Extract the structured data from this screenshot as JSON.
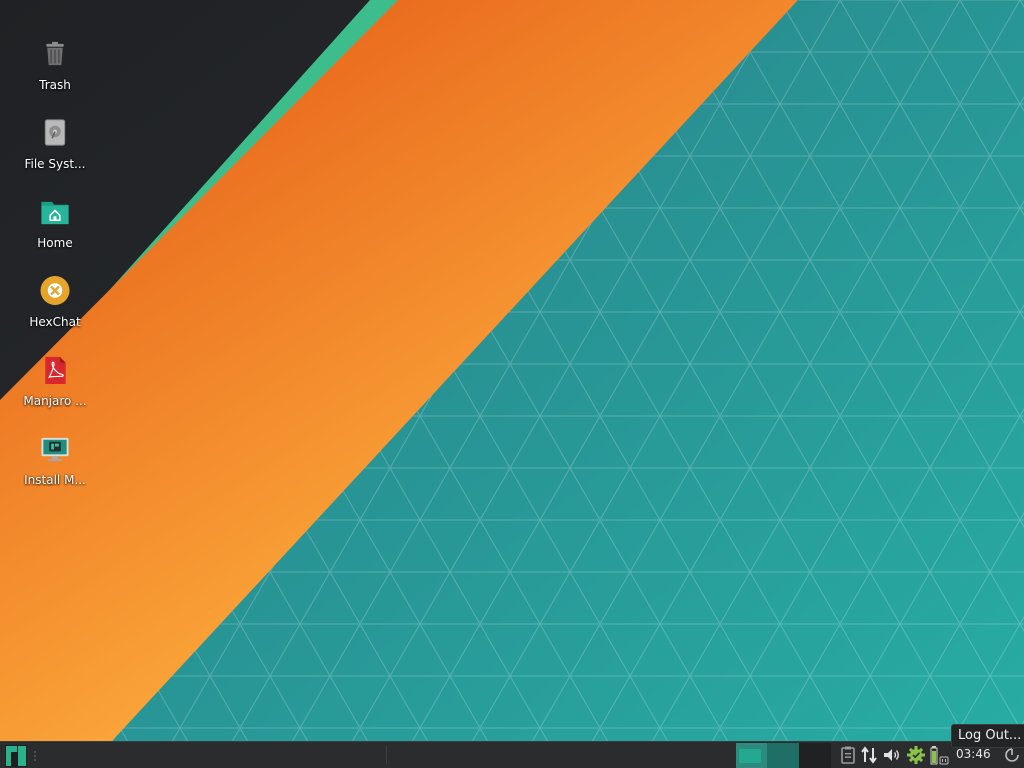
{
  "desktop": {
    "icons": [
      {
        "label": "Trash",
        "icon": "trash-icon"
      },
      {
        "label": "File Syst...",
        "icon": "drive-icon"
      },
      {
        "label": "Home",
        "icon": "home-folder-icon"
      },
      {
        "label": "HexChat",
        "icon": "hexchat-icon"
      },
      {
        "label": "Manjaro ...",
        "icon": "pdf-icon"
      },
      {
        "label": "Install M...",
        "icon": "installer-icon"
      }
    ]
  },
  "taskbar": {
    "menu_icon": "manjaro-logo-icon",
    "workspaces": [
      {
        "number": 1,
        "active": true
      },
      {
        "number": 2,
        "active": false
      },
      {
        "number": 3,
        "active": false
      }
    ],
    "tray_icons": [
      "clipboard-icon",
      "network-icon",
      "volume-icon",
      "update-gear-icon",
      "battery-icon",
      "power-icon"
    ],
    "clock": "03:46",
    "tooltip": "Log Out..."
  },
  "colors": {
    "wallpaper_dark": "#25272b",
    "stripe_green": "#3dbd8c",
    "stripe_orange": "#ef7a22",
    "teal": "#2a8d92",
    "panel": "#2b2c2e"
  }
}
